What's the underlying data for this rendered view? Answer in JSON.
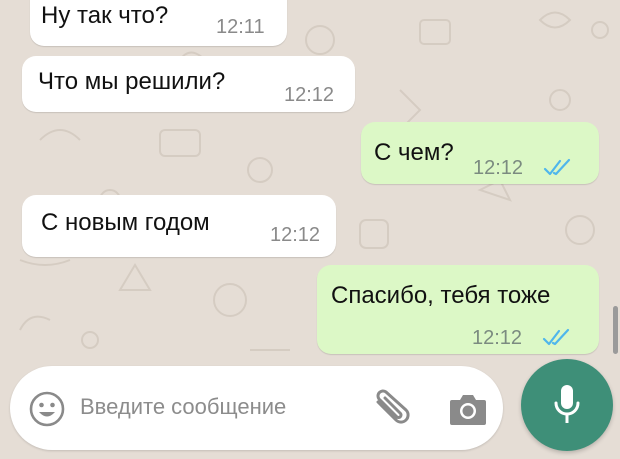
{
  "colors": {
    "chat_background": "#e5ddd5",
    "incoming_bubble": "#ffffff",
    "outgoing_bubble": "#dcf8c6",
    "read_ticks": "#4fb6ec",
    "mic_button": "#3e8f78"
  },
  "messages": [
    {
      "direction": "incoming",
      "text": "Ну так что?",
      "time": "12:11"
    },
    {
      "direction": "incoming",
      "text": "Что мы решили?",
      "time": "12:12"
    },
    {
      "direction": "outgoing",
      "text": "С чем?",
      "time": "12:12",
      "status": "read"
    },
    {
      "direction": "incoming",
      "text": "С новым годом",
      "time": "12:12"
    },
    {
      "direction": "outgoing",
      "text": "Спасибо, тебя тоже",
      "time": "12:12",
      "status": "read"
    }
  ],
  "composer": {
    "placeholder": "Введите сообщение",
    "emoji_icon": "smiley-icon",
    "attach_icon": "paperclip-icon",
    "camera_icon": "camera-icon",
    "send_icon": "microphone-icon"
  }
}
